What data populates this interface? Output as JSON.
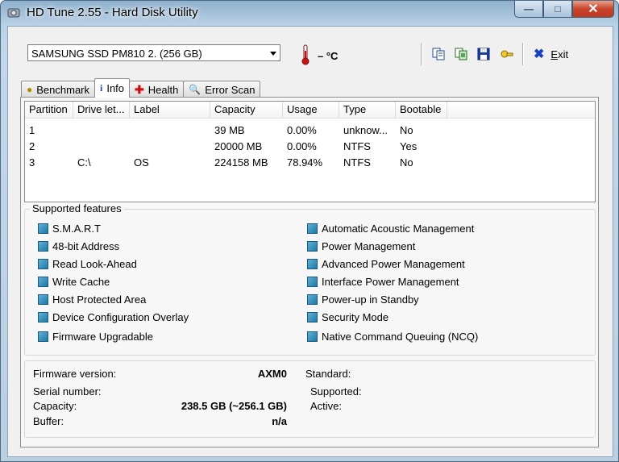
{
  "window": {
    "title": "HD Tune 2.55 - Hard Disk Utility"
  },
  "drive": {
    "selected": "SAMSUNG SSD PM810 2. (256 GB)"
  },
  "temperature": {
    "value": "– °C"
  },
  "toolbar": {
    "exit_label": "Exit",
    "exit_accel": "E",
    "exit_rest": "xit"
  },
  "tabs": [
    {
      "label": "Benchmark",
      "icon": "benchmark-icon"
    },
    {
      "label": "Info",
      "icon": "info-icon"
    },
    {
      "label": "Health",
      "icon": "health-icon"
    },
    {
      "label": "Error Scan",
      "icon": "error-scan-icon"
    }
  ],
  "partitions": {
    "columns": [
      "Partition",
      "Drive let...",
      "Label",
      "Capacity",
      "Usage",
      "Type",
      "Bootable"
    ],
    "rows": [
      [
        "1",
        "",
        "",
        "39 MB",
        "0.00%",
        "unknow...",
        "No"
      ],
      [
        "2",
        "",
        "",
        "20000 MB",
        "0.00%",
        "NTFS",
        "Yes"
      ],
      [
        "3",
        "C:\\",
        "OS",
        "224158 MB",
        "78.94%",
        "NTFS",
        "No"
      ]
    ]
  },
  "features": {
    "title": "Supported features",
    "left": [
      "S.M.A.R.T",
      "48-bit Address",
      "Read Look-Ahead",
      "Write Cache",
      "Host Protected Area",
      "Device Configuration Overlay",
      "Firmware Upgradable"
    ],
    "right": [
      "Automatic Acoustic Management",
      "Power Management",
      "Advanced Power Management",
      "Interface Power Management",
      "Power-up in Standby",
      "Security Mode",
      "Native Command Queuing (NCQ)"
    ]
  },
  "details": {
    "firmware_label": "Firmware version:",
    "firmware_value": "AXM0",
    "serial_label": "Serial number:",
    "serial_value": "",
    "capacity_label": "Capacity:",
    "capacity_value": "238.5 GB (~256.1 GB)",
    "buffer_label": "Buffer:",
    "buffer_value": "n/a",
    "standard_label": "Standard:",
    "supported_label": "Supported:",
    "active_label": "Active:"
  },
  "colors": {
    "accent": "#1f78a6",
    "titlebar": "#b9d1e6",
    "close": "#c7442b"
  }
}
